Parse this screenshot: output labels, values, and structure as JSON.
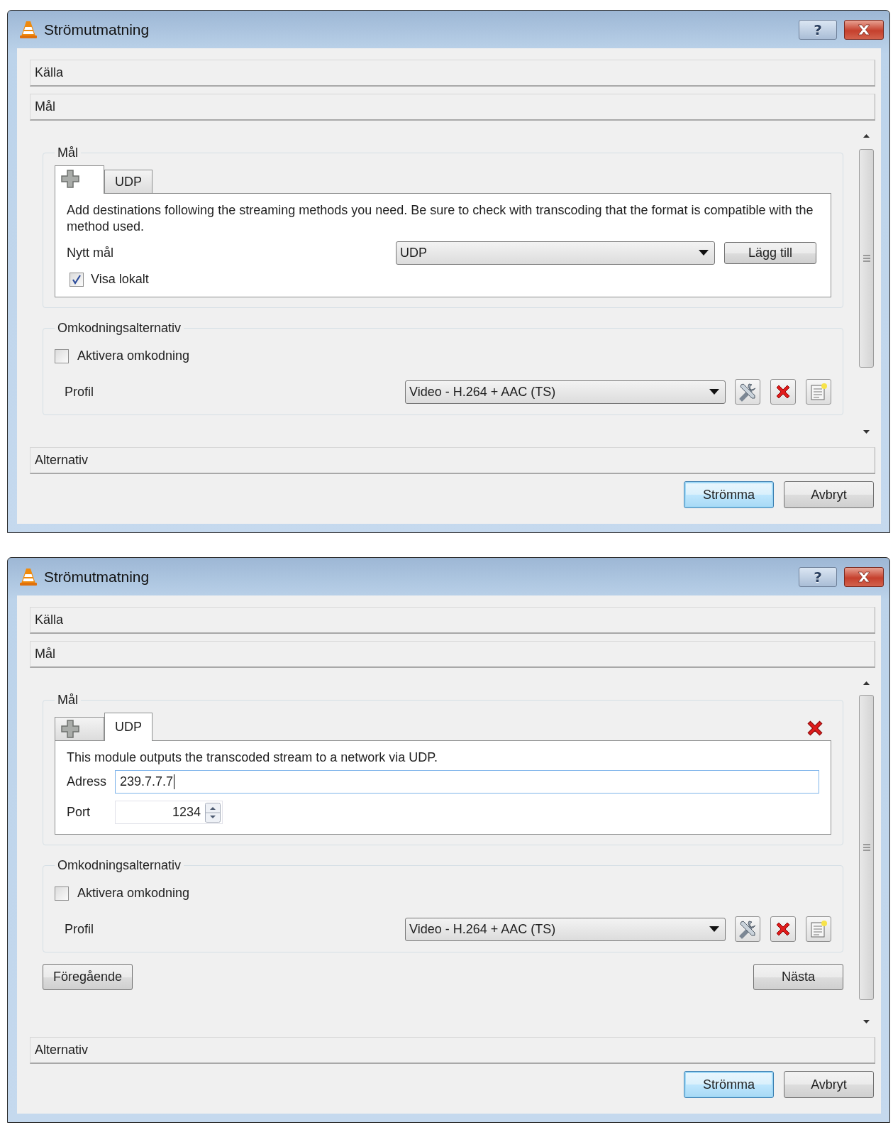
{
  "dialogs": [
    {
      "title": "Strömutmatning",
      "help_button": "?",
      "sections": [
        {
          "label": "Källa"
        },
        {
          "label": "Mål"
        }
      ],
      "destination": {
        "title": "Mål",
        "tabs": [
          {
            "kind": "add",
            "selected": true
          },
          {
            "kind": "text",
            "label": "UDP",
            "selected": false
          }
        ],
        "panel": {
          "kind": "add",
          "description": "Add destinations following the streaming methods you need. Be sure to check with transcoding that the format is compatible with the method used.",
          "new_target_label": "Nytt mål",
          "new_target_value": "UDP",
          "add_button": "Lägg till",
          "show_locally": {
            "label": "Visa lokalt",
            "checked": true
          }
        }
      },
      "transcoding": {
        "title": "Omkodningsalternativ",
        "enable": {
          "label": "Aktivera omkodning",
          "checked": false
        },
        "profile_label": "Profil",
        "profile_value": "Video - H.264 + AAC (TS)"
      },
      "options_label": "Alternativ",
      "buttons": [
        {
          "label": "Strömma",
          "default": true
        },
        {
          "label": "Avbryt",
          "default": false
        }
      ]
    },
    {
      "title": "Strömutmatning",
      "help_button": "?",
      "sections": [
        {
          "label": "Källa"
        },
        {
          "label": "Mål"
        }
      ],
      "destination": {
        "title": "Mål",
        "tabs": [
          {
            "kind": "add",
            "selected": false
          },
          {
            "kind": "text",
            "label": "UDP",
            "selected": true
          }
        ],
        "panel": {
          "kind": "udp",
          "description": "This module outputs the transcoded stream to a network via UDP.",
          "address_label": "Adress",
          "address_value": "239.7.7.7",
          "port_label": "Port",
          "port_value": "1234"
        }
      },
      "transcoding": {
        "title": "Omkodningsalternativ",
        "enable": {
          "label": "Aktivera omkodning",
          "checked": false
        },
        "profile_label": "Profil",
        "profile_value": "Video - H.264 + AAC (TS)"
      },
      "navigation": {
        "previous": "Föregående",
        "next": "Nästa"
      },
      "options_label": "Alternativ",
      "buttons": [
        {
          "label": "Strömma",
          "default": true
        },
        {
          "label": "Avbryt",
          "default": false
        }
      ]
    }
  ]
}
